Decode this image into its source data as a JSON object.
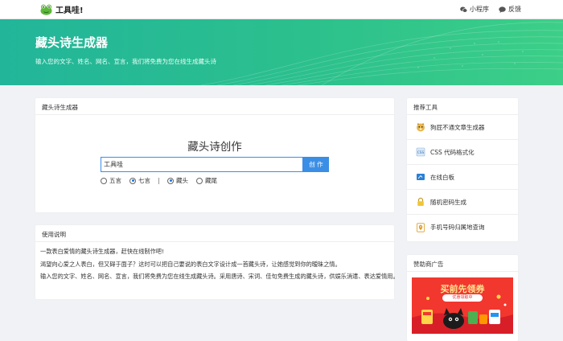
{
  "header": {
    "logo_text": "工具哇!",
    "links": [
      {
        "label": "小程序",
        "icon": "wechat-icon"
      },
      {
        "label": "反馈",
        "icon": "chat-icon"
      }
    ]
  },
  "hero": {
    "title": "藏头诗生成器",
    "subtitle": "输入您的文字、姓名、网名、宣言，我们将免费为您在线生成藏头诗"
  },
  "generator": {
    "card_title": "藏头诗生成器",
    "heading": "藏头诗创作",
    "input_value": "工具哇",
    "button_label": "创 作",
    "options": [
      {
        "label": "五言",
        "checked": false
      },
      {
        "label": "七言",
        "checked": true
      },
      {
        "label": "藏头",
        "checked": true
      },
      {
        "label": "藏尾",
        "checked": false
      }
    ]
  },
  "usage": {
    "card_title": "使用说明",
    "paragraphs": [
      "一款表白爱情的藏头诗生成器，赶快在线制作吧!",
      "渴望向心爱之人表白，但又碍于面子？这时可以把自己要说的表白文字设计成一首藏头诗，让她感觉到你的暧昧之情。",
      "输入您的文字、姓名、网名、宣言，我们将免费为您在线生成藏头诗。采用唐诗、宋词、佳句免费生成的藏头诗，供娱乐消遣、表达爱情用。"
    ]
  },
  "recommended": {
    "title": "推荐工具",
    "items": [
      {
        "label": "狗屁不通文章生成器",
        "icon": "doge-icon"
      },
      {
        "label": "CSS 代码格式化",
        "icon": "css-icon"
      },
      {
        "label": "在线白板",
        "icon": "whiteboard-icon"
      },
      {
        "label": "随机密码生成",
        "icon": "lock-icon"
      },
      {
        "label": "手机号码归属地查询",
        "icon": "location-icon"
      }
    ]
  },
  "sponsor": {
    "title": "赞助商广告",
    "ad_title": "买前先领券",
    "ad_sub": "优惠领取中"
  },
  "colors": {
    "hero_start": "#22b59a",
    "hero_end": "#3ccf88",
    "primary": "#3a8ee6"
  }
}
